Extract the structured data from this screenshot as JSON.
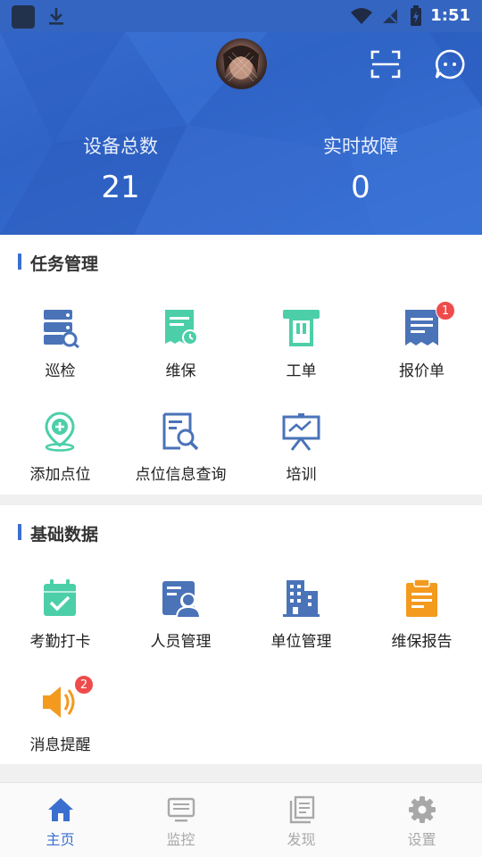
{
  "status_bar": {
    "time": "1:51"
  },
  "header": {
    "stats": [
      {
        "label": "设备总数",
        "value": "21"
      },
      {
        "label": "实时故障",
        "value": "0"
      }
    ]
  },
  "task_section": {
    "title": "任务管理",
    "items": [
      {
        "label": "巡检",
        "icon": "server-search-icon",
        "color": "#4a73b8"
      },
      {
        "label": "维保",
        "icon": "receipt-clock-icon",
        "color": "#4ccfa8"
      },
      {
        "label": "工单",
        "icon": "ticket-printer-icon",
        "color": "#4ccfa8"
      },
      {
        "label": "报价单",
        "icon": "quote-receipt-icon",
        "color": "#4a73b8",
        "badge": "1"
      },
      {
        "label": "添加点位",
        "icon": "add-location-icon",
        "color": "#4ccfa8"
      },
      {
        "label": "点位信息查询",
        "icon": "document-search-icon",
        "color": "#4a73b8"
      },
      {
        "label": "培训",
        "icon": "presentation-board-icon",
        "color": "#4a73b8"
      }
    ]
  },
  "basic_section": {
    "title": "基础数据",
    "items": [
      {
        "label": "考勤打卡",
        "icon": "calendar-check-icon",
        "color": "#4ccfa8"
      },
      {
        "label": "人员管理",
        "icon": "personnel-card-icon",
        "color": "#4a73b8"
      },
      {
        "label": "单位管理",
        "icon": "building-icon",
        "color": "#4a73b8"
      },
      {
        "label": "维保报告",
        "icon": "clipboard-report-icon",
        "color": "#f39a1f"
      },
      {
        "label": "消息提醒",
        "icon": "speaker-icon",
        "color": "#f39a1f",
        "badge": "2"
      }
    ]
  },
  "bottom_nav": [
    {
      "label": "主页",
      "icon": "home-icon",
      "active": true
    },
    {
      "label": "监控",
      "icon": "monitor-icon",
      "active": false
    },
    {
      "label": "发现",
      "icon": "book-stack-icon",
      "active": false
    },
    {
      "label": "设置",
      "icon": "gear-icon",
      "active": false
    }
  ],
  "colors": {
    "header_blue": "#3a6fd0",
    "accent_blue": "#3a6fd0",
    "teal": "#4ccfa8",
    "orange": "#f39a1f",
    "badge_red": "#ef4b4b"
  }
}
